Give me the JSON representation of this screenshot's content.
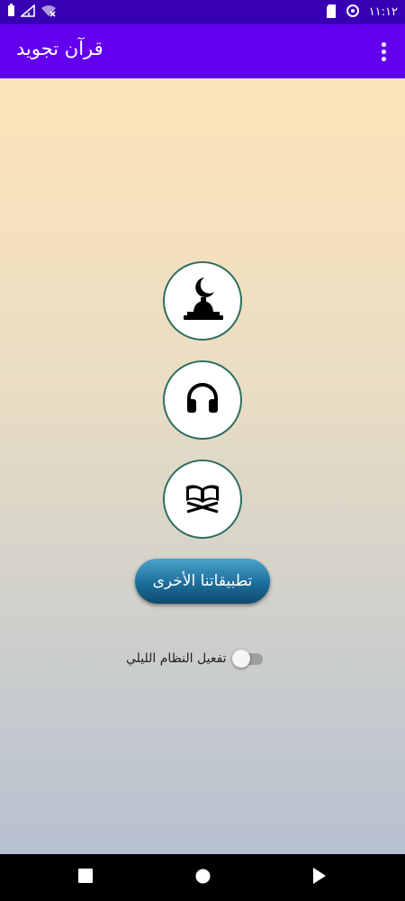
{
  "status_bar": {
    "time": "١١:١٢",
    "icons": [
      "battery-icon",
      "signal-icon",
      "wifi-off-icon",
      "sd-card-icon",
      "sync-icon"
    ]
  },
  "app_bar": {
    "title": "قرآن تجويد",
    "overflow_icon": "overflow-menu-icon"
  },
  "main": {
    "buttons": [
      {
        "name": "adhan-button",
        "icon": "minaret-crescent-icon"
      },
      {
        "name": "audio-button",
        "icon": "headphones-icon"
      },
      {
        "name": "quran-button",
        "icon": "open-quran-icon"
      }
    ],
    "other_apps_label": "تطبيقاتنا الأخرى",
    "night_mode_label": "تفعيل النظام الليلي",
    "night_mode_on": false
  },
  "nav_bar": {
    "icons": [
      "recents-icon",
      "home-icon",
      "back-icon"
    ]
  },
  "colors": {
    "status_bar": "#3700b3",
    "app_bar": "#6200ee",
    "circle_border": "#2f6e5e",
    "pill_button": "#1c6e9b"
  }
}
